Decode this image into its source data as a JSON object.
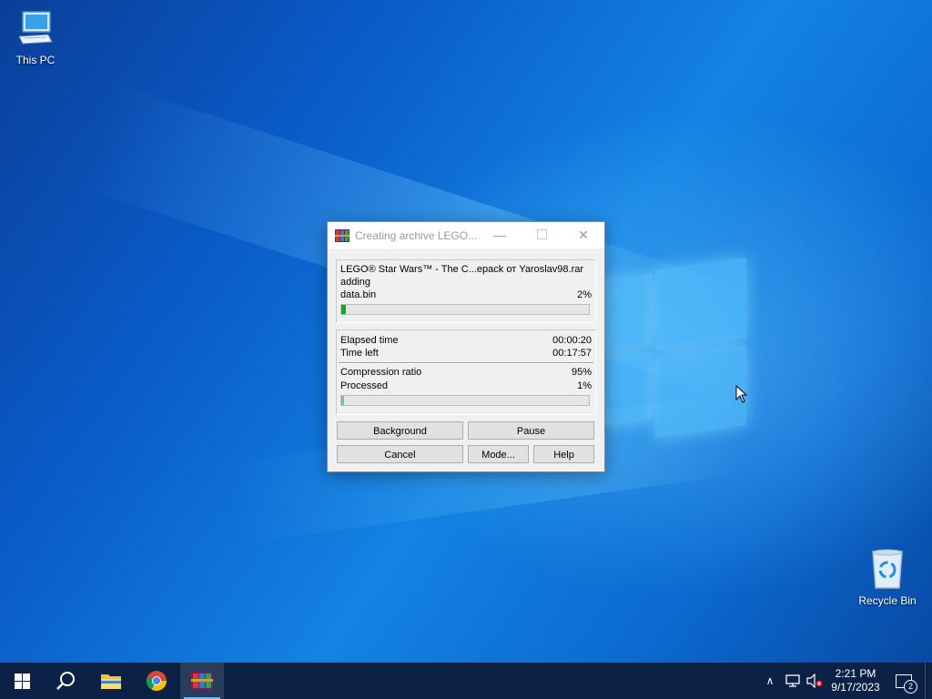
{
  "desktop": {
    "icons": [
      {
        "label": "This PC"
      },
      {
        "label": "Recycle Bin"
      }
    ]
  },
  "dialog": {
    "title": "Creating archive LEGO...",
    "archive_name": "LEGO® Star Wars™ - The C...epack от Yaroslav98.rar",
    "action": "adding",
    "current_file": "data.bin",
    "file_percent": "2%",
    "file_progress": 0.02,
    "elapsed_label": "Elapsed time",
    "elapsed_value": "00:00:20",
    "timeleft_label": "Time left",
    "timeleft_value": "00:17:57",
    "ratio_label": "Compression ratio",
    "ratio_value": "95%",
    "processed_label": "Processed",
    "processed_value": "1%",
    "processed_progress": 0.01,
    "buttons": {
      "background": "Background",
      "pause": "Pause",
      "cancel": "Cancel",
      "mode": "Mode...",
      "help": "Help"
    }
  },
  "taskbar": {
    "apps": [
      "start-icon",
      "search-icon",
      "file-explorer-icon",
      "chrome-icon",
      "winrar-icon"
    ],
    "clock_time": "2:21 PM",
    "clock_date": "9/17/2023",
    "notification_count": "2"
  },
  "colors": {
    "taskbar": "#0b2246",
    "progress_green": "#06b025",
    "dialog_bg": "#f0f0f0"
  }
}
